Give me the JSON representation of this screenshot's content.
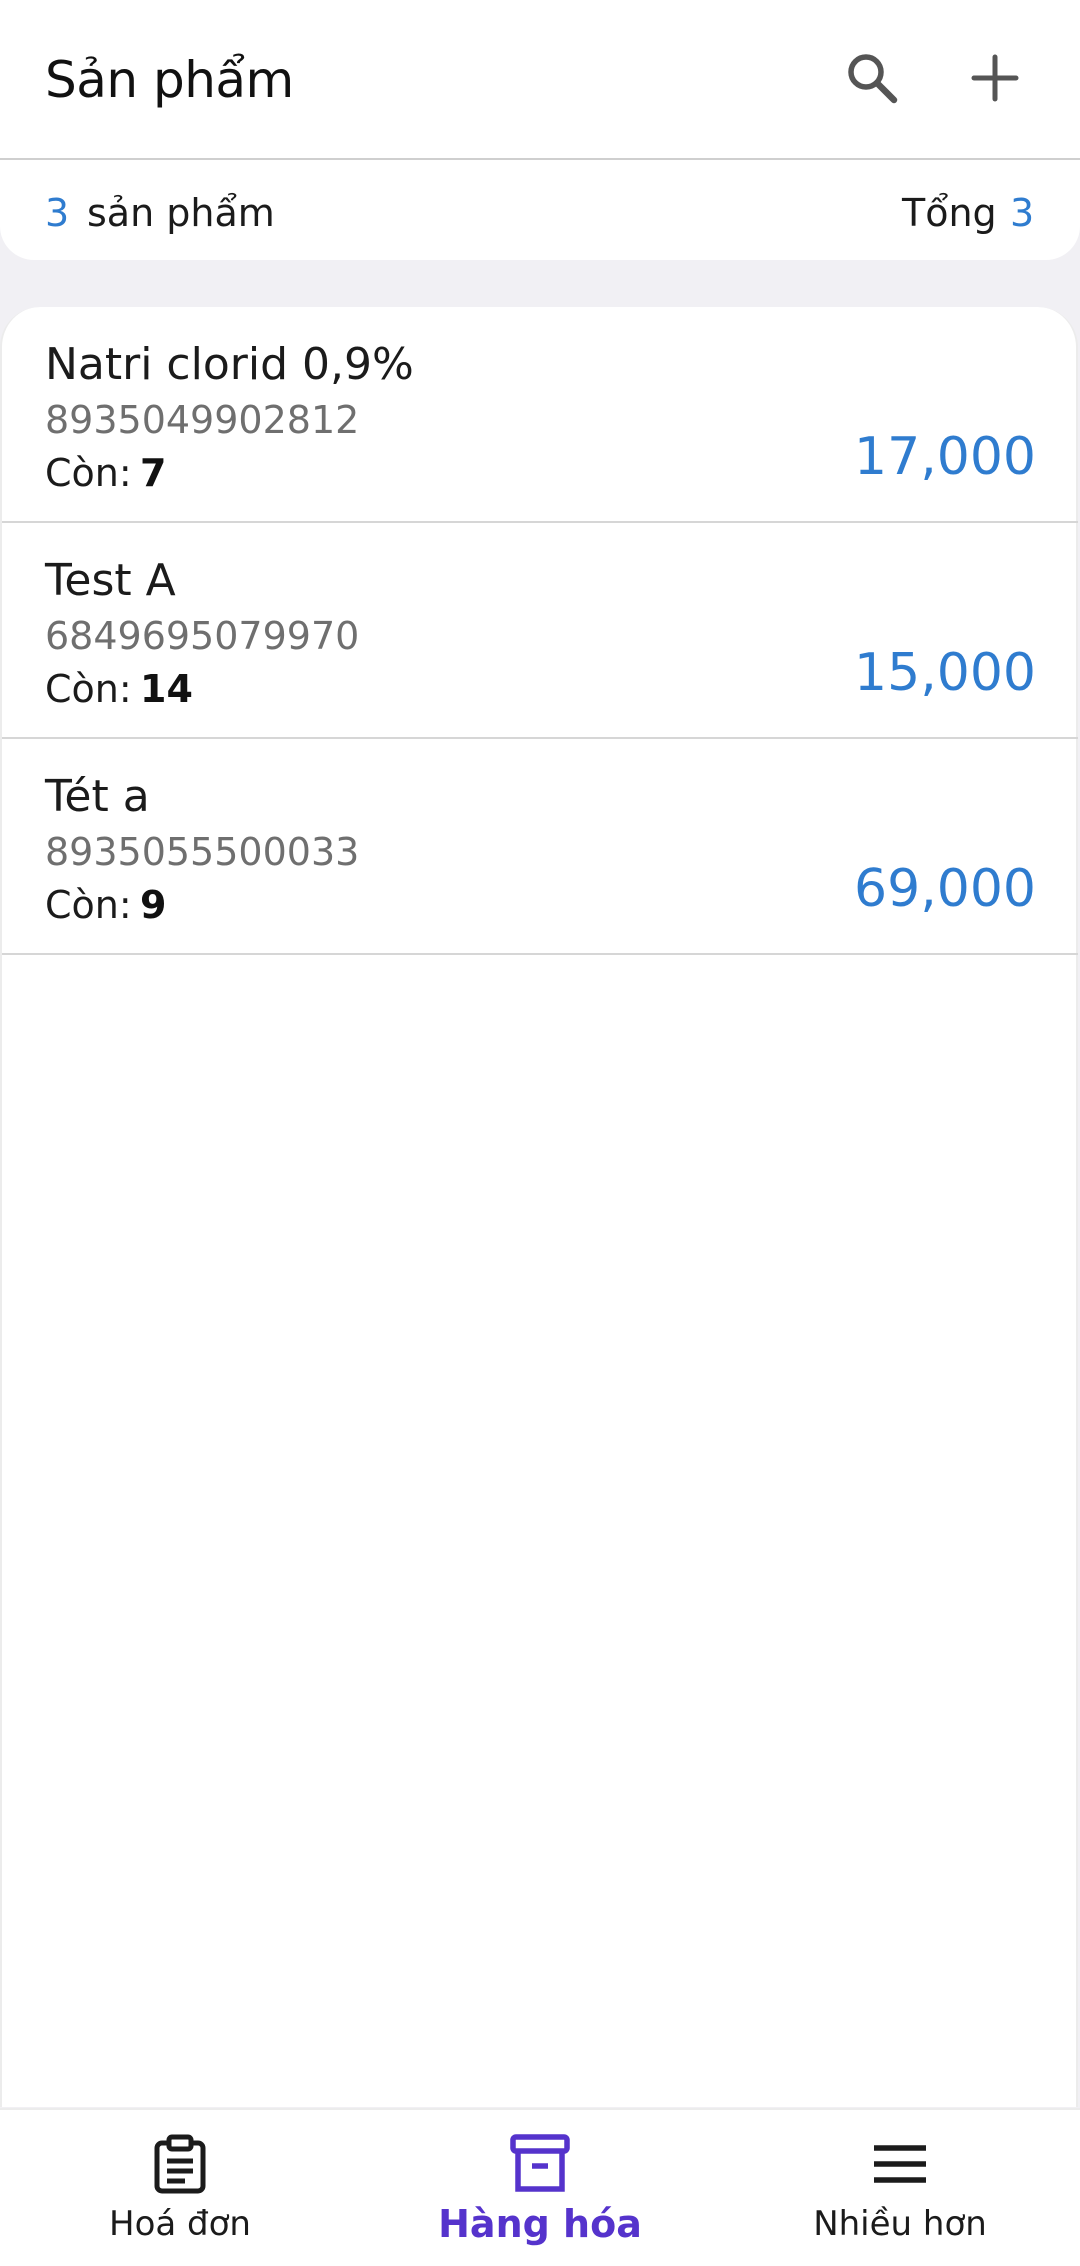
{
  "header": {
    "title": "Sản phẩm",
    "search_icon": "search-icon",
    "add_icon": "plus-icon"
  },
  "summary": {
    "count": "3",
    "count_label": "sản phẩm",
    "total_label": "Tổng",
    "total_value": "3"
  },
  "products": [
    {
      "name": "Natri clorid 0,9%",
      "barcode": "8935049902812",
      "stock_label": "Còn:",
      "stock_value": "7",
      "price": "17,000"
    },
    {
      "name": "Test A",
      "barcode": "6849695079970",
      "stock_label": "Còn:",
      "stock_value": "14",
      "price": "15,000"
    },
    {
      "name": "Tét a",
      "barcode": "8935055500033",
      "stock_label": "Còn:",
      "stock_value": "9",
      "price": "69,000"
    }
  ],
  "bottom_nav": {
    "items": [
      {
        "label": "Hoá đơn",
        "icon": "clipboard-icon",
        "active": false
      },
      {
        "label": "Hàng hóa",
        "icon": "archive-box-icon",
        "active": true
      },
      {
        "label": "Nhiều hơn",
        "icon": "menu-icon",
        "active": false
      }
    ]
  },
  "colors": {
    "accent": "#2f7ccf",
    "nav_active": "#5533cc",
    "background": "#f1f0f4"
  }
}
